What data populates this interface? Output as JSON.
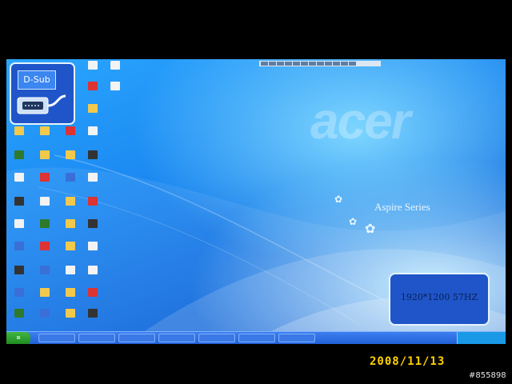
{
  "desktop": {
    "brand": "acer",
    "series": "Aspire Series",
    "taskbar": {
      "tasks": [
        "",
        "",
        "",
        "",
        "",
        "",
        ""
      ]
    }
  },
  "osd": {
    "input_label": "D-Sub",
    "resolution": "1920*1200 57HZ"
  },
  "photo": {
    "date": "2008/11/13",
    "watermark": "#855898"
  },
  "colors": {
    "date": "#ffd200",
    "desktop_blue": "#1a86f0",
    "osd_border": "#e6f4ff"
  }
}
